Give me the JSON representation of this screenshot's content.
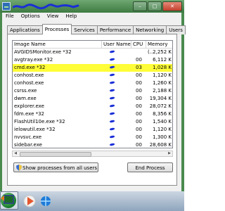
{
  "menu": [
    "File",
    "Options",
    "View",
    "Help"
  ],
  "tabs": [
    "Applications",
    "Processes",
    "Services",
    "Performance",
    "Networking",
    "Users"
  ],
  "active_tab": "Processes",
  "columns": [
    "Image Name",
    "User Name",
    "CPU",
    "Memory (..."
  ],
  "rows": [
    {
      "name": "AVGIDSMonitor.exe *32",
      "cpu": "",
      "mem": "2,252 K"
    },
    {
      "name": "avgtray.exe *32",
      "cpu": "00",
      "mem": "6,112 K"
    },
    {
      "name": "cmd.exe *32",
      "cpu": "03",
      "mem": "1,028 K"
    },
    {
      "name": "conhost.exe",
      "cpu": "00",
      "mem": "1,120 K"
    },
    {
      "name": "conhost.exe",
      "cpu": "00",
      "mem": "1,260 K"
    },
    {
      "name": "csrss.exe",
      "cpu": "00",
      "mem": "2,188 K"
    },
    {
      "name": "dwm.exe",
      "cpu": "00",
      "mem": "19,304 K"
    },
    {
      "name": "explorer.exe",
      "cpu": "00",
      "mem": "28,072 K"
    },
    {
      "name": "fdm.exe *32",
      "cpu": "00",
      "mem": "8,356 K"
    },
    {
      "name": "FlashUtil10e.exe *32",
      "cpu": "00",
      "mem": "1,540 K"
    },
    {
      "name": "ielowutil.exe *32",
      "cpu": "00",
      "mem": "1,120 K"
    },
    {
      "name": "nvvsvc.exe",
      "cpu": "00",
      "mem": "1,300 K"
    },
    {
      "name": "sidebar.exe",
      "cpu": "00",
      "mem": "28,608 K"
    },
    {
      "name": "SnippingTool.exe",
      "cpu": "00",
      "mem": "3,540 K"
    }
  ],
  "highlighted_row": "cmd.exe *32",
  "show_all_label": "Show processes from all users",
  "end_process_label": "End Process",
  "window_buttons": {
    "minimize": "–",
    "maximize": "□",
    "close": "✕"
  },
  "colors": {
    "title_green": "#4a8a4e",
    "highlight": "#fffd38",
    "redaction_blue": "#1b2fd6"
  }
}
